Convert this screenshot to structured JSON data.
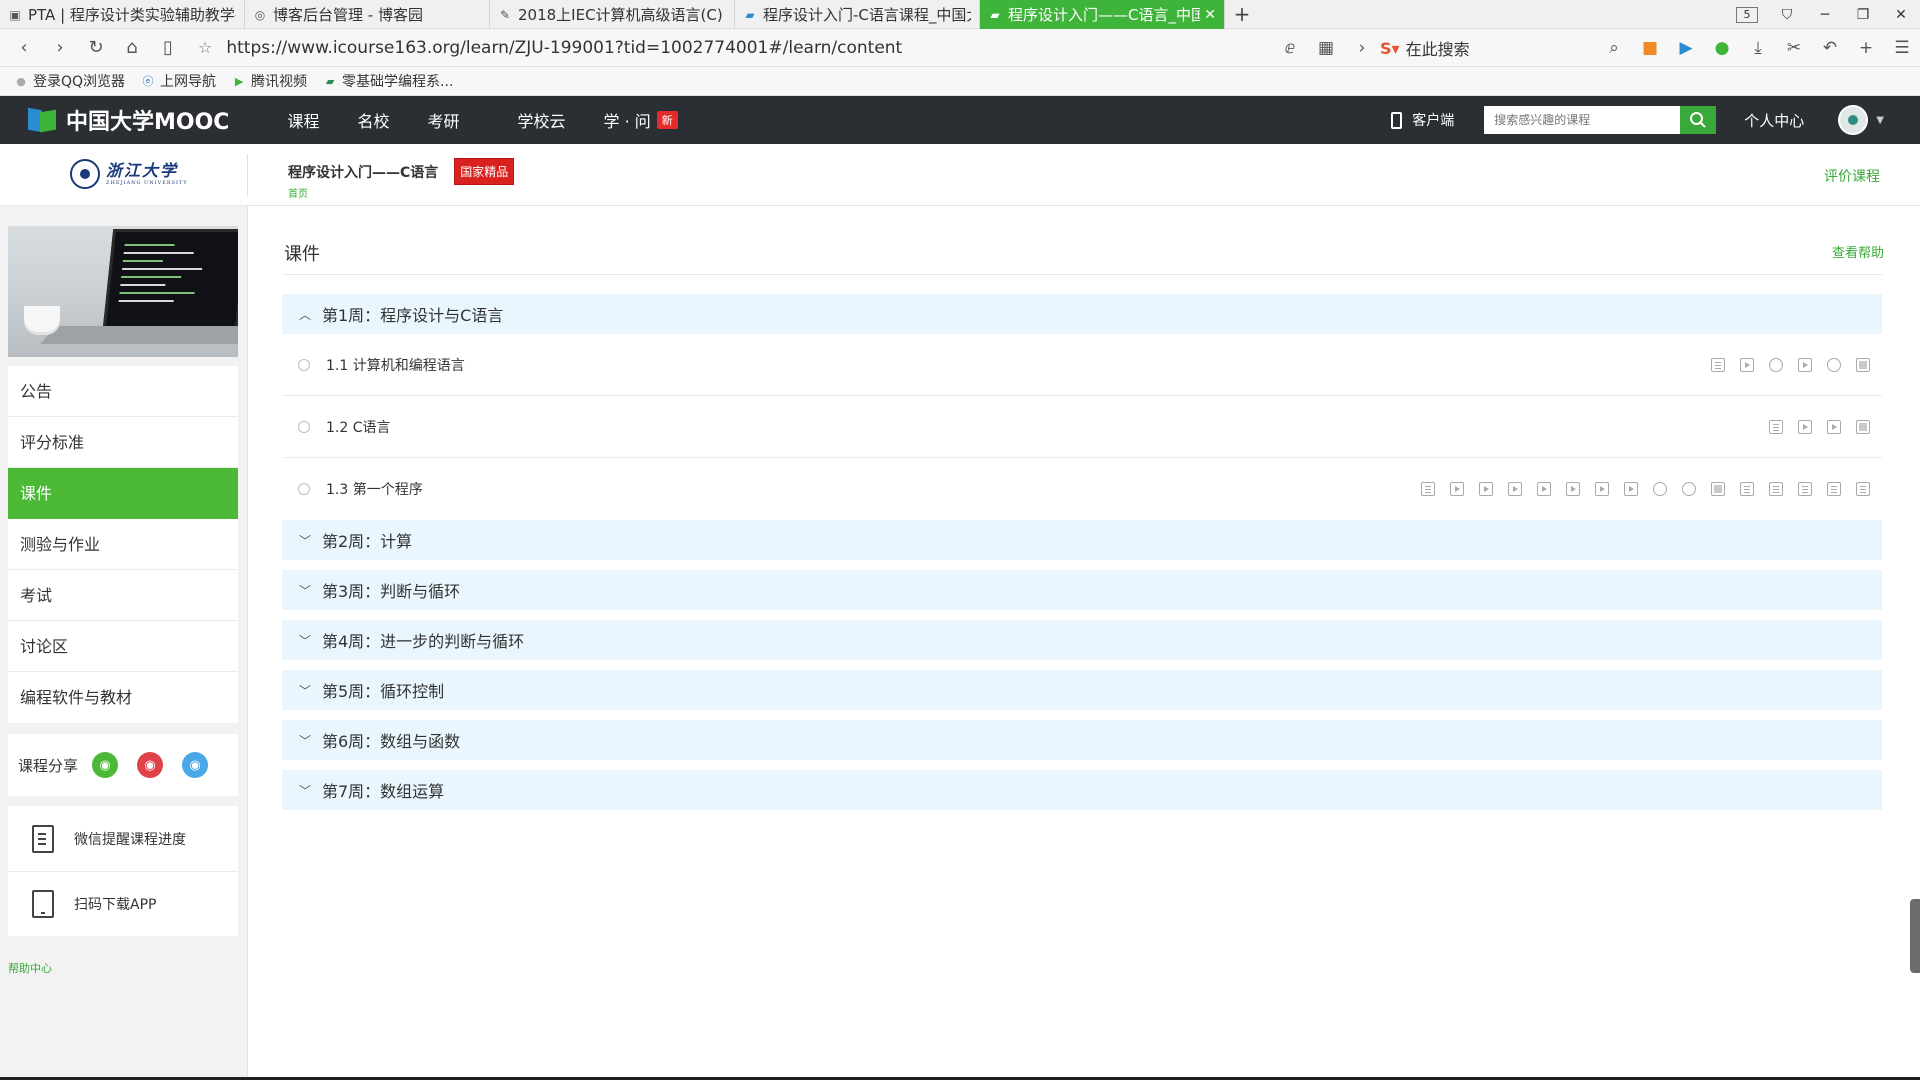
{
  "browser": {
    "tabs": [
      {
        "label": "PTA | 程序设计类实验辅助教学平台",
        "icon": "pta-icon",
        "active": false
      },
      {
        "label": "博客后台管理 - 博客园",
        "icon": "globe-icon",
        "active": false
      },
      {
        "label": "2018上IEC计算机高级语言(C)",
        "icon": "pen-icon",
        "active": false
      },
      {
        "label": "程序设计入门-C语言课程_中国大学MOOC",
        "icon": "mooc-icon",
        "active": false
      },
      {
        "label": "程序设计入门——C语言_中国大学MOOC",
        "icon": "mooc-icon",
        "active": true
      }
    ],
    "tab_count": "5",
    "url": "https://www.icourse163.org/learn/ZJU-199001?tid=1002774001#/learn/content",
    "search_placeholder": "在此搜索",
    "bookmarks": [
      {
        "label": "登录QQ浏览器",
        "icon": "user-icon"
      },
      {
        "label": "上网导航",
        "icon": "e-icon"
      },
      {
        "label": "腾讯视频",
        "icon": "play-icon"
      },
      {
        "label": "零基础学编程系...",
        "icon": "book-icon"
      }
    ]
  },
  "site": {
    "logo_text": "中国大学MOOC",
    "nav": [
      "课程",
      "名校",
      "考研",
      "学校云",
      "学 · 问"
    ],
    "new_badge": "新",
    "client_label": "客户端",
    "search_placeholder": "搜索感兴趣的课程",
    "personal_center": "个人中心"
  },
  "course": {
    "university_cn": "浙江大学",
    "university_en": "ZHEJIANG UNIVERSITY",
    "title": "程序设计入门——C语言",
    "badge": "国家精品",
    "status": "首页",
    "rate_link": "评价课程"
  },
  "sidebar": {
    "items": [
      "公告",
      "评分标准",
      "课件",
      "测验与作业",
      "考试",
      "讨论区",
      "编程软件与教材"
    ],
    "active_index": 2,
    "share_label": "课程分享",
    "share_icons": [
      "wechat-icon",
      "weibo-icon",
      "qq-icon"
    ],
    "remind_label": "微信提醒课程进度",
    "download_label": "扫码下载APP",
    "help_center": "帮助中心"
  },
  "content": {
    "title": "课件",
    "help_link": "查看帮助",
    "weeks": [
      {
        "label": "第1周：程序设计与C语言",
        "expanded": true
      },
      {
        "label": "第2周：计算",
        "expanded": false
      },
      {
        "label": "第3周：判断与循环",
        "expanded": false
      },
      {
        "label": "第4周：进一步的判断与循环",
        "expanded": false
      },
      {
        "label": "第5周：循环控制",
        "expanded": false
      },
      {
        "label": "第6周：数组与函数",
        "expanded": false
      },
      {
        "label": "第7周：数组运算",
        "expanded": false
      }
    ],
    "lessons": [
      {
        "label": "1.1 计算机和编程语言",
        "resources": [
          "doc",
          "video",
          "discuss",
          "video",
          "discuss",
          "quiz"
        ]
      },
      {
        "label": "1.2 C语言",
        "resources": [
          "doc",
          "video",
          "video",
          "quiz"
        ]
      },
      {
        "label": "1.3 第一个程序",
        "resources": [
          "doc",
          "video",
          "video",
          "video",
          "video",
          "video",
          "video",
          "video",
          "discuss",
          "discuss",
          "quiz",
          "doc",
          "doc",
          "doc",
          "doc",
          "doc"
        ]
      }
    ]
  }
}
